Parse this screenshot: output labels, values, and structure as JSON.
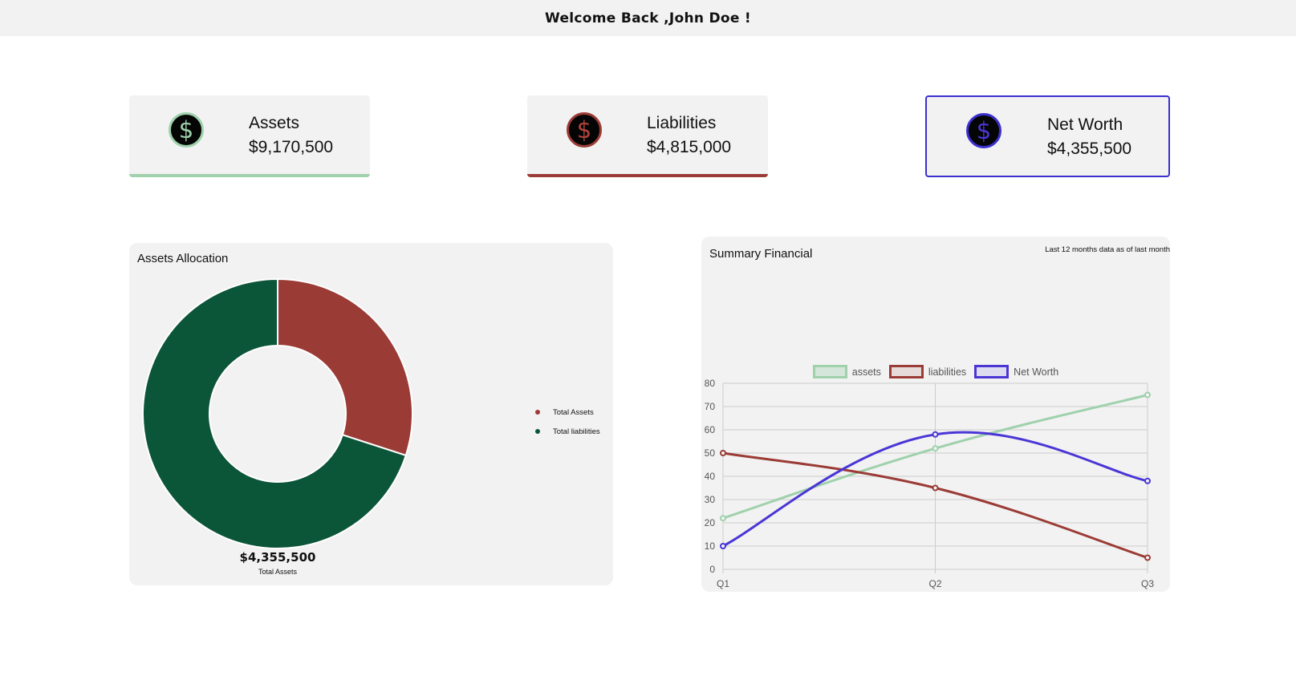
{
  "header": {
    "title": "Welcome Back ,John Doe !"
  },
  "cards": {
    "assets": {
      "label": "Assets",
      "value": "$9,170,500",
      "icon": "dollar-icon",
      "symbol": "$",
      "color": "#9fd1ac"
    },
    "liabilities": {
      "label": "Liabilities",
      "value": "$4,815,000",
      "icon": "dollar-icon",
      "symbol": "$",
      "color": "#9b3b35"
    },
    "net_worth": {
      "label": "Net Worth",
      "value": "$4,355,500",
      "icon": "dollar-icon",
      "symbol": "$",
      "color": "#3b2fcf"
    }
  },
  "allocation": {
    "title": "Assets Allocation",
    "center_value": "$4,355,500",
    "center_label": "Total Assets",
    "legend": [
      {
        "label": "Total Assets",
        "color": "#9b3b35"
      },
      {
        "label": "Total liabilities",
        "color": "#0b5538"
      }
    ]
  },
  "summary": {
    "title": "Summary Financial",
    "note": "Last 12 months data as of last month"
  },
  "chart_data": [
    {
      "type": "pie",
      "labels": [
        "Total Assets",
        "Total liabilities"
      ],
      "values": [
        30,
        70
      ],
      "colors": [
        "#9b3b35",
        "#0b5538"
      ]
    },
    {
      "type": "line",
      "x": [
        "Q1",
        "Q2",
        "Q3"
      ],
      "series": [
        {
          "name": "assets",
          "values": [
            22,
            52,
            75
          ],
          "color": "#9fd1ac"
        },
        {
          "name": "liabilities",
          "values": [
            50,
            35,
            5
          ],
          "color": "#9b3b35"
        },
        {
          "name": "Net Worth",
          "values": [
            10,
            58,
            38
          ],
          "color": "#4a36d6"
        }
      ],
      "yticks": [
        "0",
        "10",
        "20",
        "30",
        "40",
        "50",
        "60",
        "70",
        "80"
      ],
      "ylim": [
        0,
        80
      ],
      "grid": true,
      "legend": "top"
    }
  ]
}
